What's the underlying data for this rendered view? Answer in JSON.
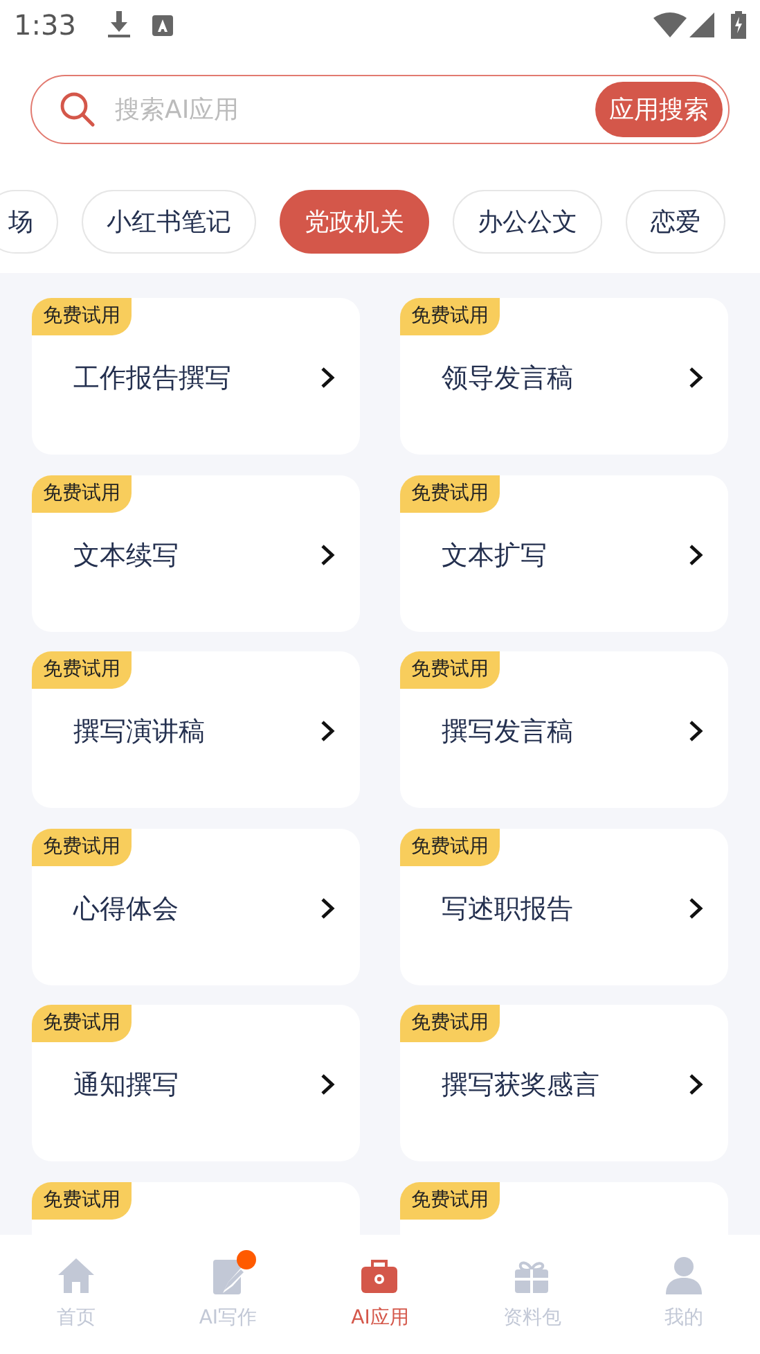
{
  "status_bar": {
    "time": "1:33"
  },
  "search": {
    "placeholder": "搜索AI应用",
    "button": "应用搜索"
  },
  "categories": [
    {
      "label": "场",
      "selected": false
    },
    {
      "label": "小红书笔记",
      "selected": false
    },
    {
      "label": "党政机关",
      "selected": true
    },
    {
      "label": "办公公文",
      "selected": false
    },
    {
      "label": "恋爱",
      "selected": false
    }
  ],
  "apps": [
    {
      "badge": "免费试用",
      "title": "工作报告撰写"
    },
    {
      "badge": "免费试用",
      "title": "领导发言稿"
    },
    {
      "badge": "免费试用",
      "title": "文本续写"
    },
    {
      "badge": "免费试用",
      "title": "文本扩写"
    },
    {
      "badge": "免费试用",
      "title": "撰写演讲稿"
    },
    {
      "badge": "免费试用",
      "title": "撰写发言稿"
    },
    {
      "badge": "免费试用",
      "title": "心得体会"
    },
    {
      "badge": "免费试用",
      "title": "写述职报告"
    },
    {
      "badge": "免费试用",
      "title": "通知撰写"
    },
    {
      "badge": "免费试用",
      "title": "撰写获奖感言"
    },
    {
      "badge": "免费试用"
    },
    {
      "badge": "免费试用"
    }
  ],
  "tab_bar": [
    {
      "label": "首页",
      "kind": "home",
      "selected": false,
      "dot": false
    },
    {
      "label": "AI写作",
      "kind": "write",
      "selected": false,
      "dot": true
    },
    {
      "label": "AI应用",
      "kind": "toolbox",
      "selected": true,
      "dot": false
    },
    {
      "label": "资料包",
      "kind": "gift",
      "selected": false,
      "dot": false
    },
    {
      "label": "我的",
      "kind": "user",
      "selected": false,
      "dot": false
    }
  ]
}
